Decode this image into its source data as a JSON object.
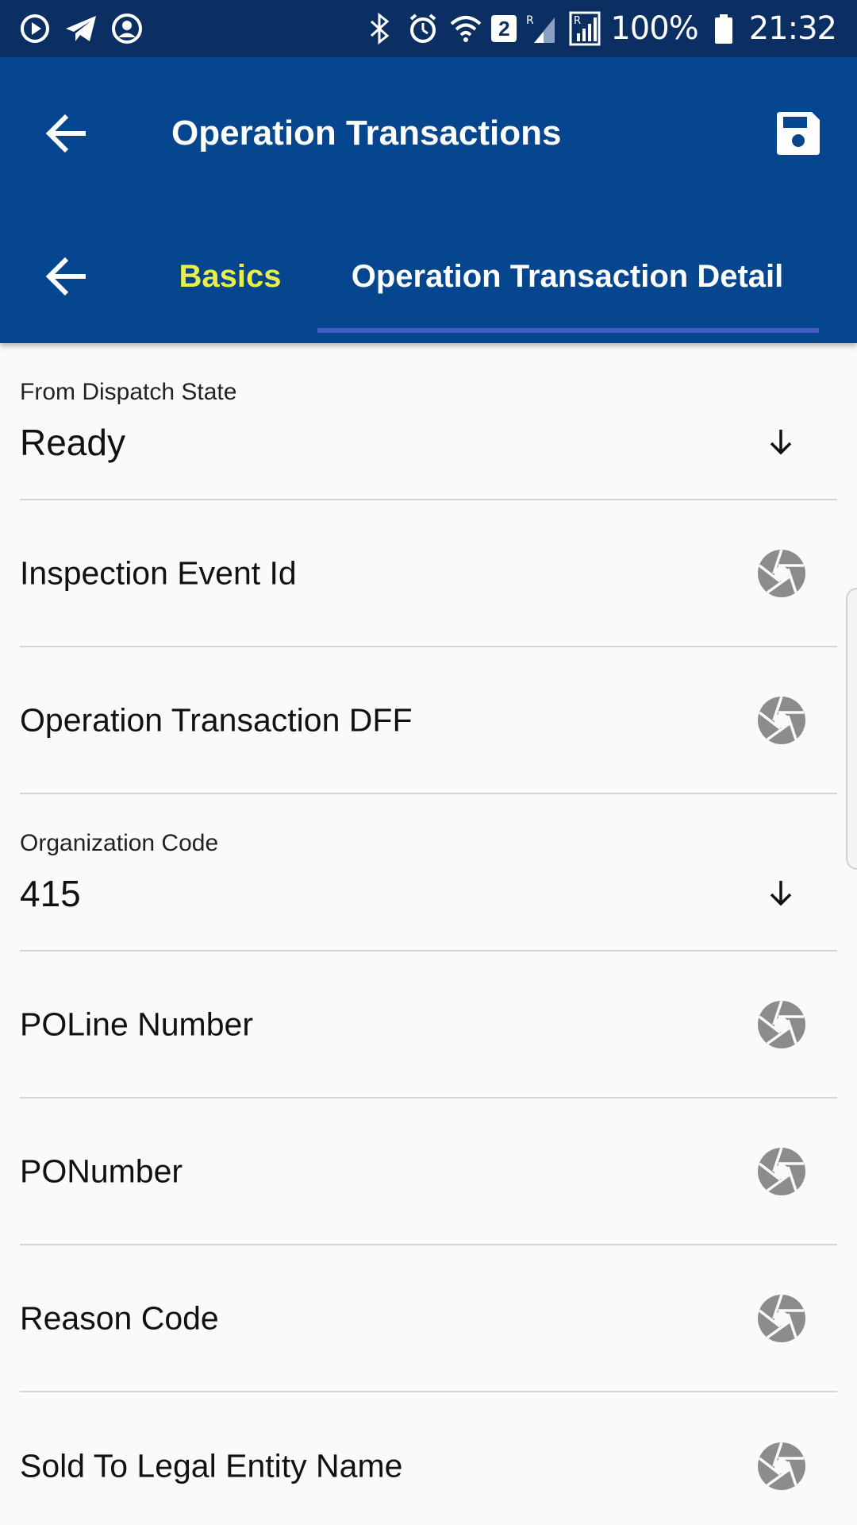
{
  "status_bar": {
    "battery": "100%",
    "time": "21:32",
    "sim_badge": "2"
  },
  "app_bar": {
    "title": "Operation Transactions"
  },
  "tabs": [
    {
      "label": "Basics",
      "active": false,
      "color": "#e9ee4c"
    },
    {
      "label": "Operation Transaction Detail",
      "active": true,
      "color": "#ffffff"
    }
  ],
  "fields": {
    "from_dispatch_state": {
      "label": "From Dispatch State",
      "value": "Ready"
    },
    "inspection_event_id": {
      "label": "Inspection Event Id"
    },
    "operation_transaction_dff": {
      "label": "Operation Transaction DFF"
    },
    "organization_code": {
      "label": "Organization Code",
      "value": "415"
    },
    "poline_number": {
      "label": "POLine Number"
    },
    "ponumber": {
      "label": "PONumber"
    },
    "reason_code": {
      "label": "Reason Code"
    },
    "sold_to_legal_entity_name": {
      "label": "Sold To Legal Entity Name"
    }
  },
  "colors": {
    "status_bar": "#0b2f63",
    "app_bar": "#05468f",
    "active_tab_indicator": "#4a5cc7",
    "inactive_tab_text": "#e9ee4c",
    "camera_icon": "#8c8c8c"
  },
  "icons": {
    "back": "arrow-left-icon",
    "save": "floppy-disk-icon",
    "dropdown": "arrow-down-icon",
    "capture": "camera-shutter-icon"
  }
}
